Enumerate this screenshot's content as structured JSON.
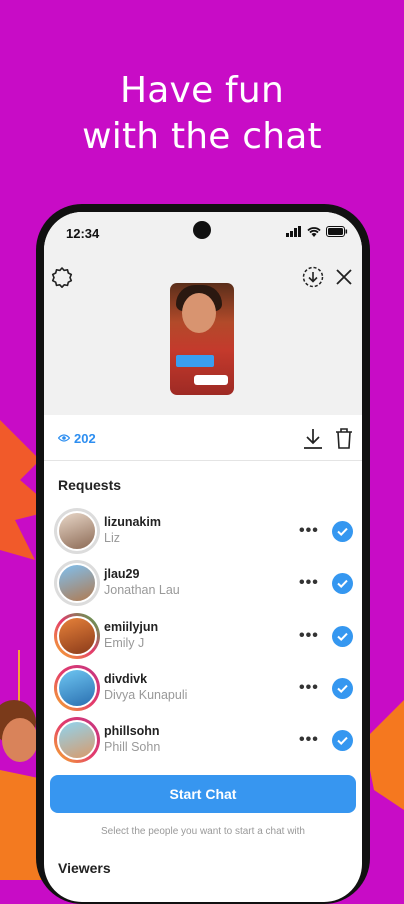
{
  "colors": {
    "background": "#c80cc6",
    "accent": "#3796f0",
    "avatar_ring": "#e33a6c"
  },
  "headline": {
    "line1": "Have fun",
    "line2": "with the chat"
  },
  "status": {
    "time": "12:34"
  },
  "icons": {
    "settings": "gear-icon",
    "download_circle": "download-circle-icon",
    "close": "close-icon",
    "views": "eye-icon",
    "download": "download-icon",
    "delete": "trash-icon",
    "approve": "checkmark-icon"
  },
  "views": {
    "count": "202"
  },
  "requests": {
    "title": "Requests",
    "items": [
      {
        "username": "lizunakim",
        "full_name": "Liz"
      },
      {
        "username": "jlau29",
        "full_name": "Jonathan Lau"
      },
      {
        "username": "emiilyjun",
        "full_name": "Emily J"
      },
      {
        "username": "divdivk",
        "full_name": "Divya Kunapuli"
      },
      {
        "username": "phillsohn",
        "full_name": "Phill Sohn"
      }
    ],
    "more_label": "•••"
  },
  "start_chat": {
    "label": "Start Chat",
    "hint": "Select the people you want to start a chat with"
  },
  "viewers": {
    "title": "Viewers"
  }
}
